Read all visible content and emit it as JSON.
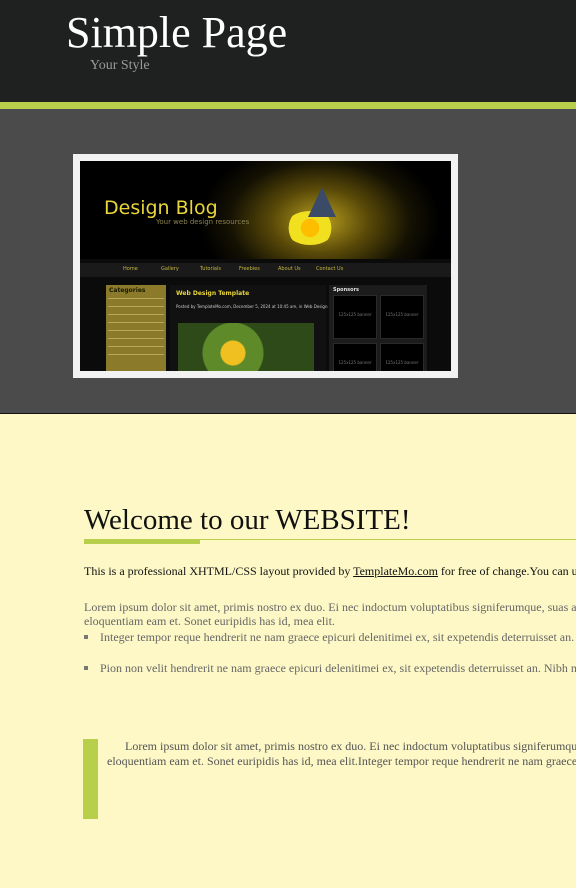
{
  "header": {
    "title": "Simple Page",
    "slogan": "Your Style"
  },
  "banner": {
    "screenshot": {
      "blog_title": "Design Blog",
      "blog_tagline": "Your web design resources",
      "nav": [
        "Home",
        "Gallery",
        "Tutorials",
        "Freebies",
        "About Us",
        "Contact Us"
      ],
      "sidebar_title": "Categories",
      "post_title": "Web Design Template",
      "post_meta": "Posted by TemplateMo.com, December 5, 2024 at 10:45 am, in Web Design",
      "sponsors_title": "Sponsors",
      "ad_label": "125x125 banner"
    }
  },
  "content": {
    "heading": "Welcome to our WEBSITE!",
    "intro_before": "This is a professional XHTML/CSS layout provided by ",
    "intro_link": "TemplateMo.com",
    "intro_after": " for free of change.You can use",
    "paragraph": "Lorem ipsum dolor sit amet, primis nostro ex duo. Ei nec indoctum voluptatibus signiferumque, suas atque eloquentiam eam et. Sonet euripidis has id, mea elit.",
    "list": [
      "Integer tempor reque hendrerit ne nam graece epicuri delenitimei ex, sit expetendis deterruisset an. Nibh",
      "Pion non velit hendrerit ne nam graece epicuri delenitimei ex, sit expetendis deterruisset an. Nibh mu"
    ],
    "blockquote": "Lorem ipsum dolor sit amet, primis nostro ex duo. Ei nec indoctum voluptatibus signiferumque, suas eloquentiam eam et. Sonet euripidis has id, mea elit.Integer tempor reque hendrerit ne nam graece epicuri"
  },
  "colors": {
    "accent": "#b7cf4a",
    "header_bg": "#1f2121",
    "banner_bg": "#4b4b4b",
    "content_bg": "#fdf8c6"
  }
}
